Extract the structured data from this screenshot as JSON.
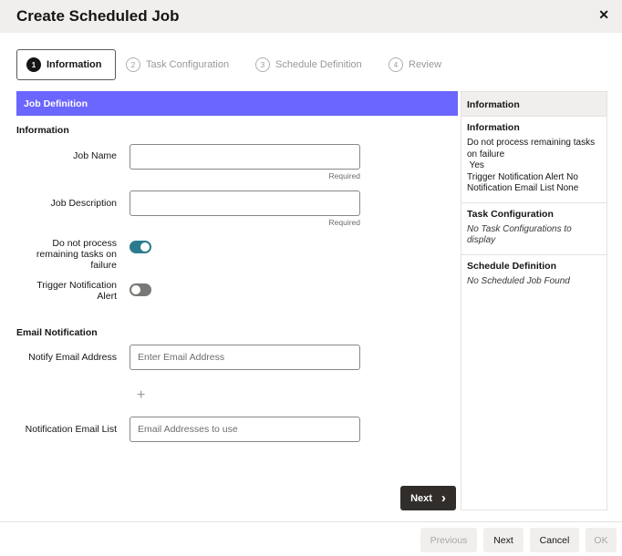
{
  "dialog": {
    "title": "Create Scheduled Job"
  },
  "steps": [
    {
      "num": "1",
      "label": "Information"
    },
    {
      "num": "2",
      "label": "Task Configuration"
    },
    {
      "num": "3",
      "label": "Schedule Definition"
    },
    {
      "num": "4",
      "label": "Review"
    }
  ],
  "form": {
    "section_title": "Job Definition",
    "information_heading": "Information",
    "job_name_label": "Job Name",
    "job_name_value": "",
    "required_text": "Required",
    "job_description_label": "Job Description",
    "job_description_value": "",
    "dont_process_label": "Do not process remaining tasks on failure",
    "dont_process_on": true,
    "trigger_alert_label": "Trigger Notification Alert",
    "trigger_alert_on": false,
    "email_heading": "Email Notification",
    "notify_email_label": "Notify Email Address",
    "notify_email_placeholder": "Enter Email Address",
    "add_symbol": "+",
    "email_list_label": "Notification Email List",
    "email_list_placeholder": "Email Addresses to use",
    "next_label": "Next",
    "next_chevron": "›"
  },
  "summary": {
    "header": "Information",
    "info_title": "Information",
    "info_line1": "Do not process remaining tasks on failure",
    "info_line2": " Yes",
    "info_line3": "Trigger Notification Alert No",
    "info_line4": "Notification Email List None",
    "task_title": "Task Configuration",
    "task_text": "No Task Configurations to display",
    "schedule_title": "Schedule Definition",
    "schedule_text": "No Scheduled Job Found"
  },
  "footer": {
    "previous": "Previous",
    "next": "Next",
    "cancel": "Cancel",
    "ok": "OK"
  },
  "colors": {
    "accent": "#6b66ff",
    "toggle_on": "#2a7b8e",
    "toggle_off": "#7a7876",
    "primary_button": "#312d2a"
  }
}
